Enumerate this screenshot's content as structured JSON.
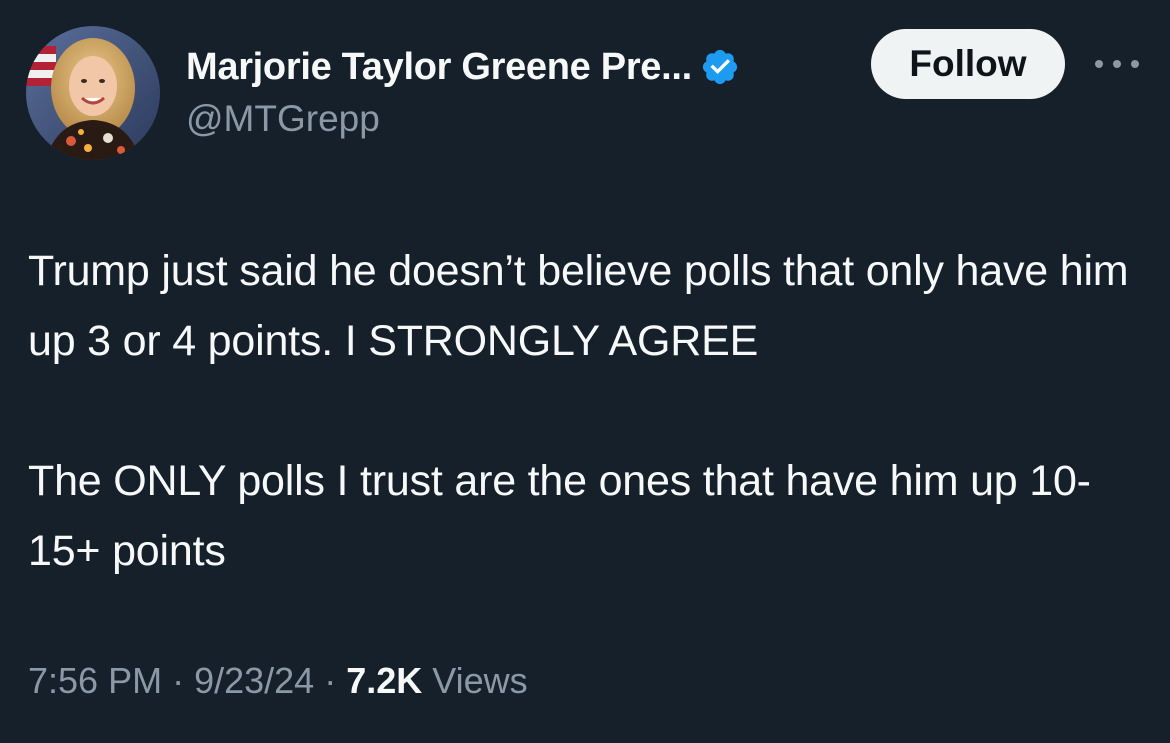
{
  "author": {
    "display_name": "Marjorie Taylor Greene Pre...",
    "handle": "@MTGrepp",
    "verified": true,
    "avatar_icon": "profile-photo"
  },
  "actions": {
    "follow_label": "Follow",
    "more_icon": "more-dots-icon"
  },
  "tweet": {
    "paragraphs": [
      "Trump just said he doesn’t believe polls that only have him up 3 or 4 points. I STRONGLY AGREE",
      "The ONLY polls I trust are the ones that have him up 10-15+ points"
    ]
  },
  "meta": {
    "time": "7:56 PM",
    "separator": "·",
    "date": "9/23/24",
    "views_count": "7.2K",
    "views_label": "Views"
  },
  "colors": {
    "background": "#15202b",
    "text_primary": "#f7f9f9",
    "text_secondary": "#8b98a5",
    "verified_blue": "#1d9bf0",
    "button_bg": "#eff3f4"
  }
}
